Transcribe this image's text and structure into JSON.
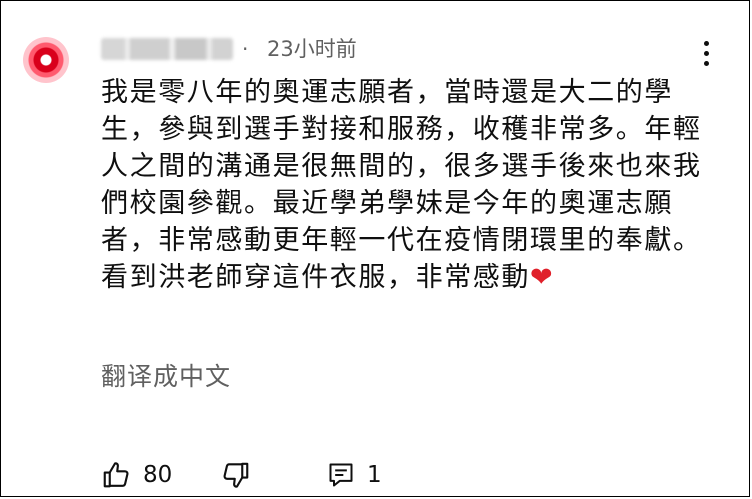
{
  "comment": {
    "time": "23小时前",
    "text": "我是零八年的奧運志願者，當時還是大二的學生，參與到選手對接和服務，收穫非常多。年輕人之間的溝通是很無間的，很多選手後來也來我們校園參觀。最近學弟學妹是今年的奧運志願者，非常感動更年輕一代在疫情閉環里的奉獻。看到洪老師穿這件衣服，非常感動",
    "lines": [
      "我是零八年的奧運志願者，當時還是大二的學",
      "生，參與到選手對接和服務，收穫非常多。年輕",
      "人之間的溝通是很無間的，很多選手後來也來我",
      "們校園參觀。最近學弟學妹是今年的奧運志願",
      "者，非常感動更年輕一代在疫情閉環里的奉獻。",
      "看到洪老師穿這件衣服，非常感動"
    ],
    "emoji": "❤",
    "translate_label": "翻译成中文",
    "like_count": "80",
    "reply_count": "1"
  },
  "icons": {
    "menu": "more-vert-icon",
    "like": "thumb-up-icon",
    "dislike": "thumb-down-icon",
    "reply": "comment-reply-icon"
  },
  "colors": {
    "heart": "#e0202a",
    "avatar_red": "#d9001b",
    "secondary_text": "#606060"
  }
}
